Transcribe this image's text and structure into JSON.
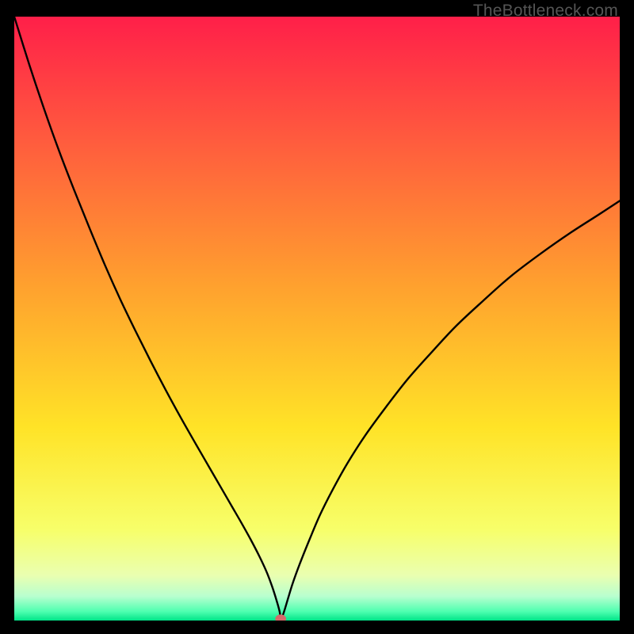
{
  "watermark": "TheBottleneck.com",
  "chart_data": {
    "type": "line",
    "title": "",
    "xlabel": "",
    "ylabel": "",
    "xlim": [
      0,
      100
    ],
    "ylim": [
      0,
      100
    ],
    "grid": false,
    "legend": false,
    "background_gradient": {
      "stops": [
        {
          "offset": 0.0,
          "color": "#ff1f49"
        },
        {
          "offset": 0.2,
          "color": "#ff5a3e"
        },
        {
          "offset": 0.45,
          "color": "#ffa22e"
        },
        {
          "offset": 0.68,
          "color": "#ffe327"
        },
        {
          "offset": 0.85,
          "color": "#f7ff6a"
        },
        {
          "offset": 0.925,
          "color": "#eaffb0"
        },
        {
          "offset": 0.96,
          "color": "#b8ffcf"
        },
        {
          "offset": 0.985,
          "color": "#4fffb0"
        },
        {
          "offset": 1.0,
          "color": "#00e488"
        }
      ]
    },
    "series": [
      {
        "name": "bottleneck-curve",
        "stroke": "#000000",
        "x": [
          0.0,
          2.5,
          5.0,
          7.5,
          10.0,
          12.5,
          15.0,
          17.5,
          20.0,
          22.5,
          25.0,
          27.5,
          30.0,
          31.5,
          33.0,
          34.5,
          36.0,
          37.5,
          39.0,
          40.5,
          41.7,
          42.6,
          43.3,
          43.8,
          44.0,
          44.2,
          44.6,
          45.2,
          46.0,
          47.2,
          48.8,
          50.5,
          52.5,
          55.0,
          58.0,
          61.5,
          65.0,
          69.0,
          73.0,
          77.5,
          82.0,
          87.0,
          92.0,
          96.5,
          100.0
        ],
        "y": [
          100.0,
          92.0,
          84.5,
          77.5,
          71.0,
          64.8,
          58.8,
          53.2,
          48.0,
          43.0,
          38.2,
          33.6,
          29.2,
          26.6,
          24.0,
          21.4,
          18.8,
          16.2,
          13.5,
          10.6,
          8.0,
          5.6,
          3.4,
          1.6,
          0.5,
          0.5,
          1.6,
          3.6,
          6.2,
          9.5,
          13.5,
          17.5,
          21.5,
          26.0,
          30.7,
          35.5,
          40.0,
          44.5,
          48.8,
          53.0,
          57.0,
          60.8,
          64.3,
          67.2,
          69.5
        ]
      }
    ],
    "marker": {
      "name": "optimal-point",
      "x": 44.0,
      "y": 0.3,
      "rx": 0.9,
      "ry": 0.7,
      "fill": "#d46a6a"
    }
  }
}
